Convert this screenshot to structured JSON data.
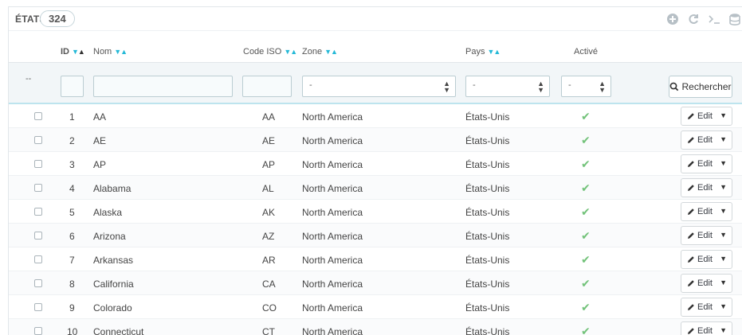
{
  "header": {
    "title": "ÉTATS",
    "count": "324"
  },
  "toolbar": {
    "icons": [
      "add-icon",
      "refresh-icon",
      "sql-query-icon",
      "database-icon"
    ]
  },
  "columns": {
    "id": "ID",
    "name": "Nom",
    "iso": "Code ISO",
    "zone": "Zone",
    "country": "Pays",
    "active": "Activé"
  },
  "filters": {
    "bulk": "--",
    "zone_value": "-",
    "country_value": "-",
    "active_value": "-",
    "search_label": "Rechercher"
  },
  "row_action": {
    "edit_label": "Edit"
  },
  "rows": [
    {
      "id": "1",
      "name": "AA",
      "iso": "AA",
      "zone": "North America",
      "country": "États-Unis"
    },
    {
      "id": "2",
      "name": "AE",
      "iso": "AE",
      "zone": "North America",
      "country": "États-Unis"
    },
    {
      "id": "3",
      "name": "AP",
      "iso": "AP",
      "zone": "North America",
      "country": "États-Unis"
    },
    {
      "id": "4",
      "name": "Alabama",
      "iso": "AL",
      "zone": "North America",
      "country": "États-Unis"
    },
    {
      "id": "5",
      "name": "Alaska",
      "iso": "AK",
      "zone": "North America",
      "country": "États-Unis"
    },
    {
      "id": "6",
      "name": "Arizona",
      "iso": "AZ",
      "zone": "North America",
      "country": "États-Unis"
    },
    {
      "id": "7",
      "name": "Arkansas",
      "iso": "AR",
      "zone": "North America",
      "country": "États-Unis"
    },
    {
      "id": "8",
      "name": "California",
      "iso": "CA",
      "zone": "North America",
      "country": "États-Unis"
    },
    {
      "id": "9",
      "name": "Colorado",
      "iso": "CO",
      "zone": "North America",
      "country": "États-Unis"
    },
    {
      "id": "10",
      "name": "Connecticut",
      "iso": "CT",
      "zone": "North America",
      "country": "États-Unis"
    }
  ],
  "colors": {
    "accent": "#25b9d7",
    "check": "#72c279",
    "filter_bg": "#f2f6f8"
  }
}
